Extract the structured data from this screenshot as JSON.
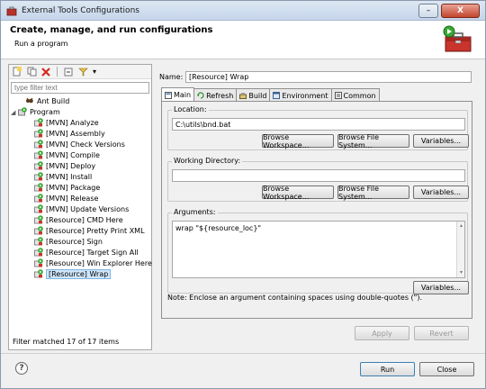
{
  "window": {
    "title": "External Tools Configurations",
    "minimize_label": "–",
    "close_label": "X"
  },
  "header": {
    "title": "Create, manage, and run configurations",
    "subtitle": "Run a program"
  },
  "left_panel": {
    "toolbar": {
      "new_icon": "new-config-icon",
      "duplicate_icon": "duplicate-icon",
      "delete_icon": "delete-icon",
      "collapse_icon": "collapse-all-icon",
      "filter_icon": "filter-icon",
      "dropdown_glyph": "▾"
    },
    "filter_placeholder": "type filter text",
    "tree": {
      "ant_build": "Ant Build",
      "program": "Program",
      "expander": "◢",
      "items": [
        "[MVN] Analyze",
        "[MVN] Assembly",
        "[MVN] Check Versions",
        "[MVN] Compile",
        "[MVN] Deploy",
        "[MVN] Install",
        "[MVN] Package",
        "[MVN] Release",
        "[MVN] Update Versions",
        "[Resource] CMD Here",
        "[Resource] Pretty Print XML",
        "[Resource] Sign",
        "[Resource] Target Sign All",
        "[Resource] Win Explorer Here",
        "[Resource] Wrap"
      ],
      "selected": "[Resource] Wrap"
    },
    "footer": "Filter matched 17 of 17 items"
  },
  "main": {
    "name_label": "Name:",
    "name_value": "[Resource] Wrap",
    "tabs": [
      {
        "label": "Main",
        "icon": "main-tab-icon"
      },
      {
        "label": "Refresh",
        "icon": "refresh-icon"
      },
      {
        "label": "Build",
        "icon": "build-icon"
      },
      {
        "label": "Environment",
        "icon": "environment-icon"
      },
      {
        "label": "Common",
        "icon": "common-icon"
      }
    ],
    "location": {
      "label": "Location:",
      "value": "C:\\utils\\bnd.bat",
      "browse_workspace": "Browse Workspace...",
      "browse_file_system": "Browse File System...",
      "variables": "Variables..."
    },
    "working_directory": {
      "label": "Working Directory:",
      "value": "",
      "browse_workspace": "Browse Workspace...",
      "browse_file_system": "Browse File System...",
      "variables": "Variables..."
    },
    "arguments": {
      "label": "Arguments:",
      "value": "wrap \"${resource_loc}\"",
      "variables": "Variables...",
      "scroll_up": "▴",
      "scroll_down": "▾"
    },
    "note": "Note: Enclose an argument containing spaces using double-quotes (\").",
    "apply": "Apply",
    "revert": "Revert"
  },
  "footer": {
    "help": "?",
    "run": "Run",
    "close": "Close"
  }
}
